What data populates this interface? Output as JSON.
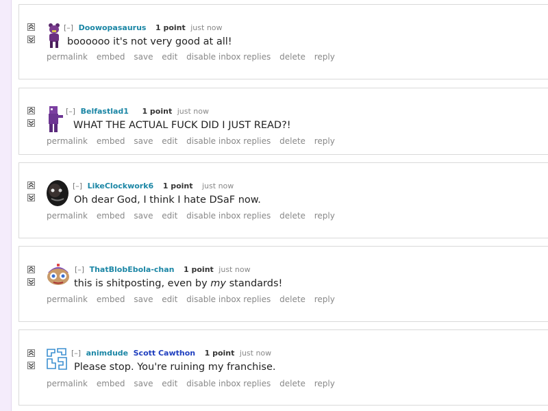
{
  "collapse_toggle": "[–]",
  "actions": [
    "permalink",
    "embed",
    "save",
    "edit",
    "disable inbox replies",
    "delete",
    "reply"
  ],
  "comments": [
    {
      "author": "Doowopasaurus",
      "score": "1 point",
      "time": "just now",
      "body": "boooooo it's not very good at all!",
      "avatar_icon": "purple-bear-icon"
    },
    {
      "author": "Belfastlad1",
      "score": "1 point",
      "time": "just now",
      "body": "WHAT THE ACTUAL FUCK DID I JUST READ?!",
      "avatar_icon": "purple-guy-icon"
    },
    {
      "author": "LikeClockwork6",
      "score": "1 point",
      "time": "just now",
      "body": "Oh dear God, I think I hate DSaF now.",
      "avatar_icon": "dark-mask-icon"
    },
    {
      "author": "ThatBlobEbola-chan",
      "score": "1 point",
      "time": "just now",
      "body_before": "this is shitposting, even by ",
      "body_em": "my",
      "body_after": " standards!",
      "avatar_icon": "balloon-boy-icon"
    },
    {
      "author": "animdude",
      "flair": "Scott Cawthon",
      "score": "1 point",
      "time": "just now",
      "body": "Please stop. You're ruining my franchise.",
      "avatar_icon": "blueprint-icon"
    }
  ],
  "colors": {
    "author": "#1b86a5",
    "flair": "#1f3fbf",
    "text": "#222222",
    "muted": "#888888",
    "border": "#d9d9d9",
    "strip": "#f4ecfb"
  }
}
